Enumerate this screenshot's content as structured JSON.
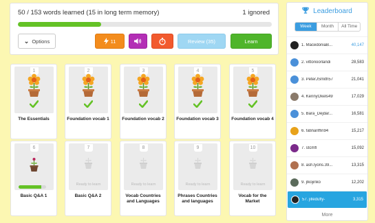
{
  "progress": {
    "text": "50 / 153 words learned (15 in long term memory)",
    "ignored": "1 ignored",
    "fraction_learned": 0.327
  },
  "toolbar": {
    "options_label": "Options",
    "bolt_count": "11",
    "review_label": "Review (35)",
    "learn_label": "Learn"
  },
  "courses": [
    {
      "num": "1",
      "name": "The Essentials",
      "state": "grown"
    },
    {
      "num": "2",
      "name": "Foundation vocab 1",
      "state": "grown"
    },
    {
      "num": "3",
      "name": "Foundation vocab 2",
      "state": "grown"
    },
    {
      "num": "4",
      "name": "Foundation vocab 3",
      "state": "grown"
    },
    {
      "num": "5",
      "name": "Foundation vocab 4",
      "state": "grown"
    },
    {
      "num": "6",
      "name": "Basic Q&A 1",
      "state": "sprout",
      "progress": 0.82
    },
    {
      "num": "7",
      "name": "Basic Q&A 2",
      "state": "ready",
      "ready_label": "Ready to learn"
    },
    {
      "num": "8",
      "name": "Vocab Countries and Languages",
      "state": "ready",
      "ready_label": "Ready to learn"
    },
    {
      "num": "9",
      "name": "Phrases Countries and languages",
      "state": "ready",
      "ready_label": "Ready to learn"
    },
    {
      "num": "10",
      "name": "Vocab for the Market",
      "state": "ready",
      "ready_label": "Ready to learn"
    }
  ],
  "leaderboard": {
    "title": "Leaderboard",
    "tabs": [
      "Week",
      "Month",
      "All Time"
    ],
    "active_tab": "Week",
    "entries": [
      {
        "name": "1. MacedoniaB...",
        "score": "40,147",
        "avatar_color": "#222222"
      },
      {
        "name": "2. vittorioorlandi",
        "score": "28,583",
        "avatar_color": "#4a90d9"
      },
      {
        "name": "3. PeterJSmith57",
        "score": "21,041",
        "avatar_color": "#4a90d9"
      },
      {
        "name": "4. KennyOkels49",
        "score": "17,029",
        "avatar_color": "#8a7a6a"
      },
      {
        "name": "5. Bara_Dejdar...",
        "score": "16,581",
        "avatar_color": "#4a90d9"
      },
      {
        "name": "6. fatinariffin94",
        "score": "15,217",
        "avatar_color": "#e8a21a"
      },
      {
        "name": "7. stcmfl",
        "score": "15,092",
        "avatar_color": "#7b2a8a"
      },
      {
        "name": "8. ash.lyons.39...",
        "score": "13,315",
        "avatar_color": "#b07050"
      },
      {
        "name": "9. jlkojinko",
        "score": "12,202",
        "avatar_color": "#5b6b5b"
      },
      {
        "name": "57. jilledufly-",
        "score": "3,315",
        "avatar_color": "#222222",
        "me": true
      }
    ],
    "more_label": "More"
  },
  "colors": {
    "accent_blue": "#3b9de0",
    "learn_green": "#4fb52b",
    "bolt_orange": "#f38c1d",
    "sound_purple": "#b32eb5",
    "timer_red": "#f25a2e",
    "review_blue": "#9fd7f3",
    "background_yellow": "#fcf7b2"
  },
  "icons": {
    "options": "chevron-down-icon",
    "bolt": "lightning-icon",
    "sound": "speaker-icon",
    "timer": "stopwatch-icon",
    "leaderboard": "trophy-icon",
    "grown": "flower-pot-icon",
    "done": "checkmark-icon",
    "ready": "empty-pot-icon"
  }
}
